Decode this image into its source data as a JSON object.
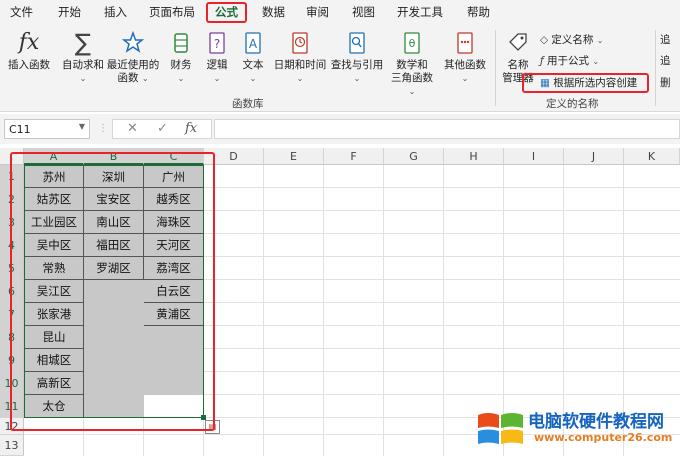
{
  "menu": {
    "tabs": [
      {
        "label": "文件"
      },
      {
        "label": "开始"
      },
      {
        "label": "插入"
      },
      {
        "label": "页面布局"
      },
      {
        "label": "公式"
      },
      {
        "label": "数据"
      },
      {
        "label": "审阅"
      },
      {
        "label": "视图"
      },
      {
        "label": "开发工具"
      },
      {
        "label": "帮助"
      }
    ],
    "active": "公式"
  },
  "ribbon": {
    "insert_function": "插入函数",
    "autosum": "自动求和",
    "recent_line1": "最近使用的",
    "recent_line2": "函数",
    "financial": "财务",
    "logical": "逻辑",
    "text": "文本",
    "datetime": "日期和时间",
    "lookup": "查找与引用",
    "math_line1": "数学和",
    "math_line2": "三角函数",
    "other": "其他函数",
    "library_group": "函数库",
    "name_manager_line1": "名称",
    "name_manager_line2": "管理器",
    "define_name": "定义名称",
    "use_in_formula": "用于公式",
    "create_from_selection": "根据所选内容创建",
    "defined_names_group": "定义的名称",
    "trace_1": "追",
    "trace_2": "追",
    "trace_3": "删"
  },
  "formula_bar": {
    "name_box": "C11",
    "cancel": "✕",
    "confirm": "✓",
    "fx": "fx",
    "value": ""
  },
  "sheet": {
    "columns": [
      "A",
      "B",
      "C",
      "D",
      "E",
      "F",
      "G",
      "H",
      "I",
      "J",
      "K"
    ],
    "rows": [
      "1",
      "2",
      "3",
      "4",
      "5",
      "6",
      "7",
      "8",
      "9",
      "10",
      "11",
      "12",
      "13"
    ],
    "col_a": [
      "苏州",
      "姑苏区",
      "工业园区",
      "吴中区",
      "常熟",
      "吴江区",
      "张家港",
      "昆山",
      "相城区",
      "高新区",
      "太仓"
    ],
    "col_b": [
      "深圳",
      "宝安区",
      "南山区",
      "福田区",
      "罗湖区"
    ],
    "col_c": [
      "广州",
      "越秀区",
      "海珠区",
      "天河区",
      "荔湾区",
      "白云区",
      "黄浦区"
    ],
    "selected_columns": [
      "A",
      "B",
      "C"
    ]
  },
  "watermark": {
    "title": "电脑软硬件教程网",
    "url": "www.computer26.com"
  },
  "colors": {
    "accent": "#1e6b3a",
    "highlight": "#e8242a",
    "selection": "#c8c8c8"
  }
}
